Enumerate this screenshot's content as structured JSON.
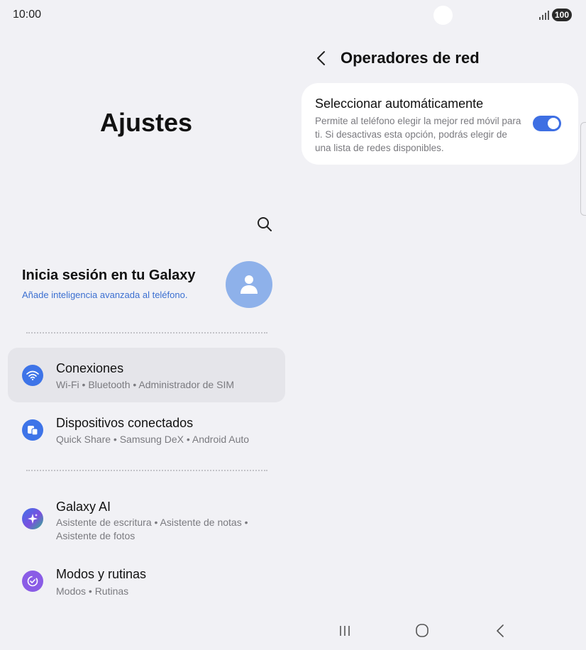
{
  "status_bar": {
    "time": "10:00",
    "battery": "100"
  },
  "left_pane": {
    "title": "Ajustes",
    "account": {
      "title": "Inicia sesión en tu Galaxy",
      "subtitle": "Añade inteligencia avanzada al teléfono."
    },
    "items": [
      {
        "title": "Conexiones",
        "subtitle": "Wi-Fi • Bluetooth • Administrador de SIM",
        "icon": "wifi-icon",
        "color": "#3e74e8",
        "selected": true
      },
      {
        "title": "Dispositivos conectados",
        "subtitle": "Quick Share • Samsung DeX • Android Auto",
        "icon": "devices-icon",
        "color": "#3e74e8"
      },
      {
        "title": "Galaxy AI",
        "subtitle": "Asistente de escritura • Asistente de notas • Asistente de fotos",
        "icon": "sparkle-icon",
        "color": "#5b5be0"
      },
      {
        "title": "Modos y rutinas",
        "subtitle": "Modos • Rutinas",
        "icon": "check-circle-icon",
        "color": "#8a5ce6"
      }
    ]
  },
  "right_pane": {
    "title": "Operadores de red",
    "setting": {
      "title": "Seleccionar automáticamente",
      "description": "Permite al teléfono elegir la mejor red móvil para ti. Si desactivas esta opción, podrás elegir de una lista de redes disponibles.",
      "toggle_on": true
    }
  },
  "colors": {
    "accent": "#3e6fe3",
    "background": "#f1f1f5",
    "link": "#3b6fd1"
  }
}
